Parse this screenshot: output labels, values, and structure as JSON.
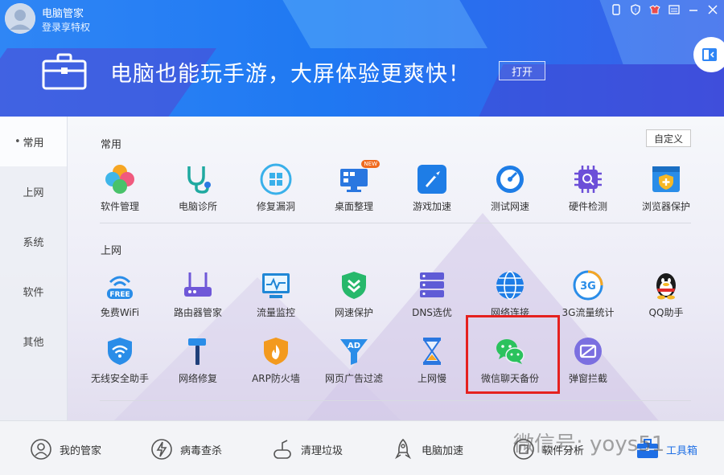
{
  "header": {
    "app_title": "电脑管家",
    "login_link": "登录享特权",
    "banner_text": "电脑也能玩手游，大屏体验更爽快！",
    "open_button": "打开"
  },
  "sidebar": {
    "items": [
      {
        "label": "常用",
        "active": true
      },
      {
        "label": "上网",
        "active": false
      },
      {
        "label": "系统",
        "active": false
      },
      {
        "label": "软件",
        "active": false
      },
      {
        "label": "其他",
        "active": false
      }
    ]
  },
  "main": {
    "customize_button": "自定义",
    "section_common": "常用",
    "section_internet": "上网",
    "common_tools": [
      {
        "label": "软件管理",
        "icon": "clover-icon"
      },
      {
        "label": "电脑诊所",
        "icon": "stethoscope-icon"
      },
      {
        "label": "修复漏洞",
        "icon": "windows-fix-icon"
      },
      {
        "label": "桌面整理",
        "icon": "desktop-icon",
        "badge": "NEW"
      },
      {
        "label": "游戏加速",
        "icon": "rocket-game-icon"
      },
      {
        "label": "测试网速",
        "icon": "speedometer-icon"
      },
      {
        "label": "硬件检测",
        "icon": "chip-icon"
      },
      {
        "label": "浏览器保护",
        "icon": "shield-plus-icon"
      }
    ],
    "internet_tools_row1": [
      {
        "label": "免费WiFi",
        "icon": "free-wifi-icon",
        "icon_text": "FREE"
      },
      {
        "label": "路由器管家",
        "icon": "router-icon"
      },
      {
        "label": "流量监控",
        "icon": "monitor-icon"
      },
      {
        "label": "网速保护",
        "icon": "shield-chevron-icon"
      },
      {
        "label": "DNS选优",
        "icon": "server-icon"
      },
      {
        "label": "网络连接",
        "icon": "globe-icon"
      },
      {
        "label": "3G流量统计",
        "icon": "3g-icon",
        "icon_text": "3G"
      },
      {
        "label": "QQ助手",
        "icon": "qq-penguin-icon"
      }
    ],
    "internet_tools_row2": [
      {
        "label": "无线安全助手",
        "icon": "wifi-shield-icon"
      },
      {
        "label": "网络修复",
        "icon": "hammer-icon"
      },
      {
        "label": "ARP防火墙",
        "icon": "fire-shield-icon"
      },
      {
        "label": "网页广告过滤",
        "icon": "ad-filter-icon",
        "icon_text": "AD"
      },
      {
        "label": "上网慢",
        "icon": "hourglass-icon"
      },
      {
        "label": "微信聊天备份",
        "icon": "wechat-icon",
        "highlighted": true
      },
      {
        "label": "弹窗拦截",
        "icon": "popup-block-icon"
      }
    ]
  },
  "bottom_nav": [
    {
      "label": "我的管家",
      "icon": "butler-icon"
    },
    {
      "label": "病毒查杀",
      "icon": "lightning-icon"
    },
    {
      "label": "清理垃圾",
      "icon": "vacuum-icon"
    },
    {
      "label": "电脑加速",
      "icon": "rocket-icon"
    },
    {
      "label": "软件分析",
      "icon": "software-icon"
    },
    {
      "label": "工具箱",
      "icon": "toolbox-icon",
      "active": true
    }
  ],
  "watermark": "微信号: yoys51",
  "colors": {
    "accent": "#1f78f2",
    "highlight": "#e5211f",
    "wechat": "#2bc25d"
  }
}
